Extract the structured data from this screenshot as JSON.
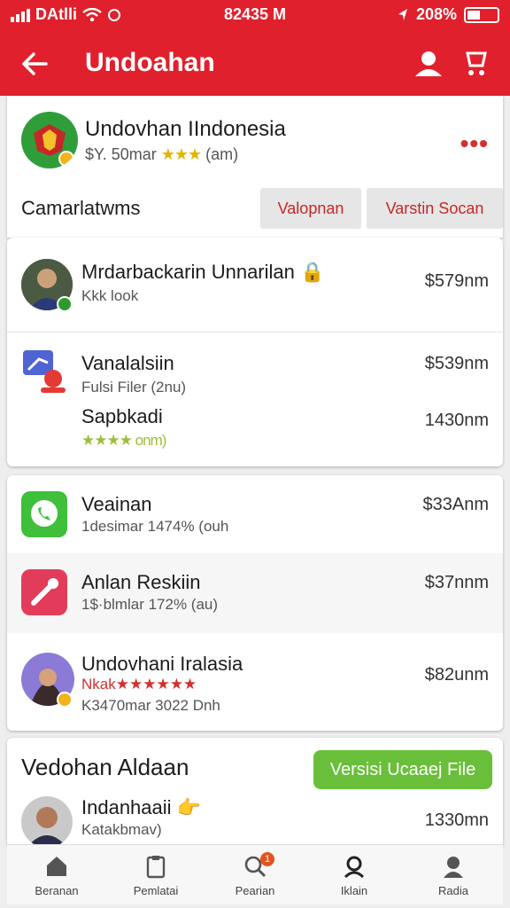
{
  "status_bar": {
    "carrier": "DAtlli",
    "time": "82435 M",
    "battery": "208%"
  },
  "app_bar": {
    "title": "Undoahan"
  },
  "header": {
    "title": "Undovhan IIndonesia",
    "meta_prefix": "$Y. 50mar",
    "meta_stars": "★★★",
    "meta_suffix": "(am)",
    "section_label": "Camarlatwms",
    "btn_left": "Valopnan",
    "btn_right": "Varstin Socan"
  },
  "list1": [
    {
      "name": "Mrdarbackarin Unnarilan",
      "sub": "Kkk look",
      "price": "$579nm"
    },
    {
      "name": "Vanalalsiin",
      "sub": "Fulsi Filer (2nu)",
      "price": "$539nm"
    },
    {
      "name": "Sapbkadi",
      "sub": "★★★★ onm)",
      "price": "1430nm"
    }
  ],
  "list2": [
    {
      "name": "Veainan",
      "sub": "1desimar 1474% (ouh",
      "price": "$33Anm"
    },
    {
      "name": "Anlan Reskiin",
      "sub": "1$·blmlar 172% (au)",
      "price": "$37nnm"
    },
    {
      "name": "Undovhani Iralasia",
      "sub_rating_label": "Nkak",
      "sub_rating_stars": "★★★★★★",
      "sub": "K3470mar 3022 Dnh",
      "price": "$82unm"
    }
  ],
  "section3": {
    "title": "Vedohan Aldaan",
    "button": "Versisi Ucaaej File",
    "person_name": "Indanhaaii",
    "person_sub": "Katakbmav)",
    "price": "1330mn"
  },
  "bottom_nav": [
    {
      "label": "Beranan",
      "icon": "home-icon"
    },
    {
      "label": "Pemlatai",
      "icon": "clipboard-icon"
    },
    {
      "label": "Pearian",
      "icon": "search-icon",
      "badge": "1"
    },
    {
      "label": "Iklain",
      "icon": "user-outline-icon"
    },
    {
      "label": "Radia",
      "icon": "profile-icon"
    }
  ],
  "colors": {
    "primary": "#e0202c",
    "accent_green": "#6abf3a",
    "star": "#e3b400"
  }
}
